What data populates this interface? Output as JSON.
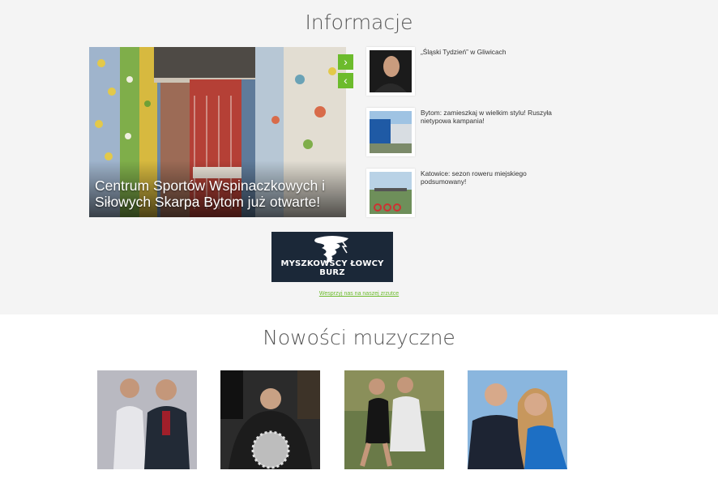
{
  "info": {
    "title": "Informacje",
    "hero": {
      "caption": "Centrum Sportów Wspinaczkowych i Siłowych Skarpa Bytom już otwarte!",
      "next_glyph": "›",
      "prev_glyph": "‹"
    },
    "side_news": [
      {
        "text": "„Śląski Tydzień” w Gliwicach"
      },
      {
        "text": "Bytom: zamieszkaj w wielkim stylu! Ruszyła nietypowa kampania!"
      },
      {
        "text": "Katowice: sezon roweru miejskiego podsumowany!"
      }
    ],
    "ad": {
      "text": "MYSZKOWSCY ŁOWCY BURZ",
      "link": "Wesprzyj nas na naszej zrzutce"
    }
  },
  "music": {
    "title": "Nowości muzyczne",
    "items": 4
  },
  "colors": {
    "accent": "#6cbb2c",
    "section_bg": "#f4f4f4"
  }
}
